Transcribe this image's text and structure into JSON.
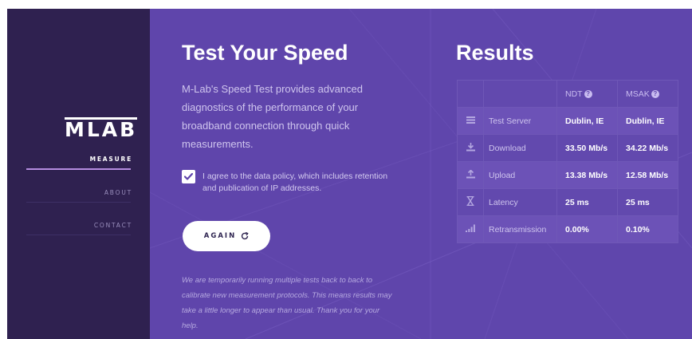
{
  "sidebar": {
    "logo": "MLAB",
    "nav": [
      {
        "label": "MEASURE",
        "active": true
      },
      {
        "label": "ABOUT",
        "active": false
      },
      {
        "label": "CONTACT",
        "active": false
      }
    ]
  },
  "main": {
    "title": "Test Your Speed",
    "description": "M-Lab's Speed Test provides advanced diagnostics of the performance of your broadband connection through quick measurements.",
    "agree_text": "I agree to the data policy, which includes retention and publication of IP addresses.",
    "agree_checked": true,
    "again_label": "AGAIN",
    "notice": "We are temporarily running multiple tests back to back to calibrate new measurement protocols. This means results may take a little longer to appear than usual. Thank you for your help."
  },
  "results": {
    "title": "Results",
    "columns": [
      "NDT",
      "MSAK"
    ],
    "rows": [
      {
        "icon": "server-icon",
        "label": "Test Server",
        "ndt": "Dublin, IE",
        "msak": "Dublin, IE"
      },
      {
        "icon": "download-icon",
        "label": "Download",
        "ndt": "33.50 Mb/s",
        "msak": "34.22 Mb/s"
      },
      {
        "icon": "upload-icon",
        "label": "Upload",
        "ndt": "13.38 Mb/s",
        "msak": "12.58 Mb/s"
      },
      {
        "icon": "hourglass-icon",
        "label": "Latency",
        "ndt": "25 ms",
        "msak": "25 ms"
      },
      {
        "icon": "signal-icon",
        "label": "Retransmission",
        "ndt": "0.00%",
        "msak": "0.10%"
      }
    ]
  },
  "colors": {
    "sidebar_bg": "#2f2150",
    "main_bg": "#5f45ab",
    "accent": "#b58ce0"
  }
}
